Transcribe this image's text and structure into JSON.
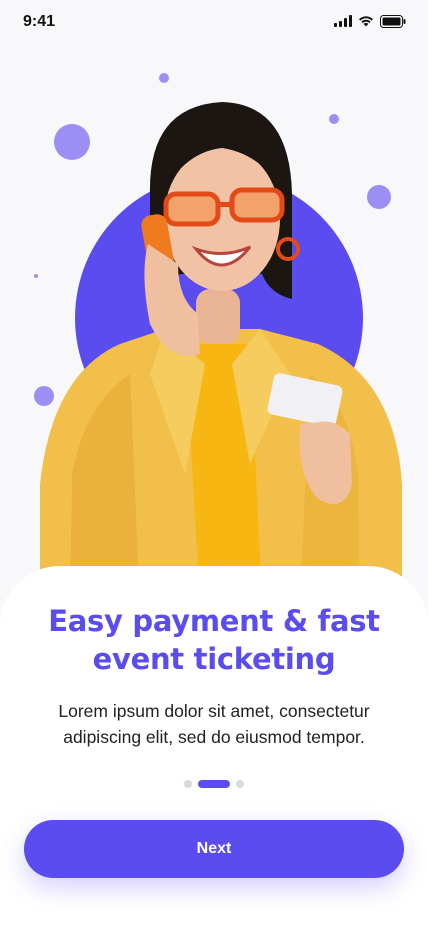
{
  "status_bar": {
    "time": "9:41"
  },
  "hero": {
    "image_description_icons": [
      "woman-with-phone-illustration"
    ],
    "accent_color": "#5b4cf0"
  },
  "onboarding": {
    "headline_line1": "Easy payment & fast",
    "headline_line2": "event ticketing",
    "body_line1": "Lorem ipsum dolor sit amet, consectetur",
    "body_line2": "adipiscing elit, sed do eiusmod tempor.",
    "pager": {
      "total": 3,
      "active_index": 1
    },
    "next_label": "Next"
  }
}
